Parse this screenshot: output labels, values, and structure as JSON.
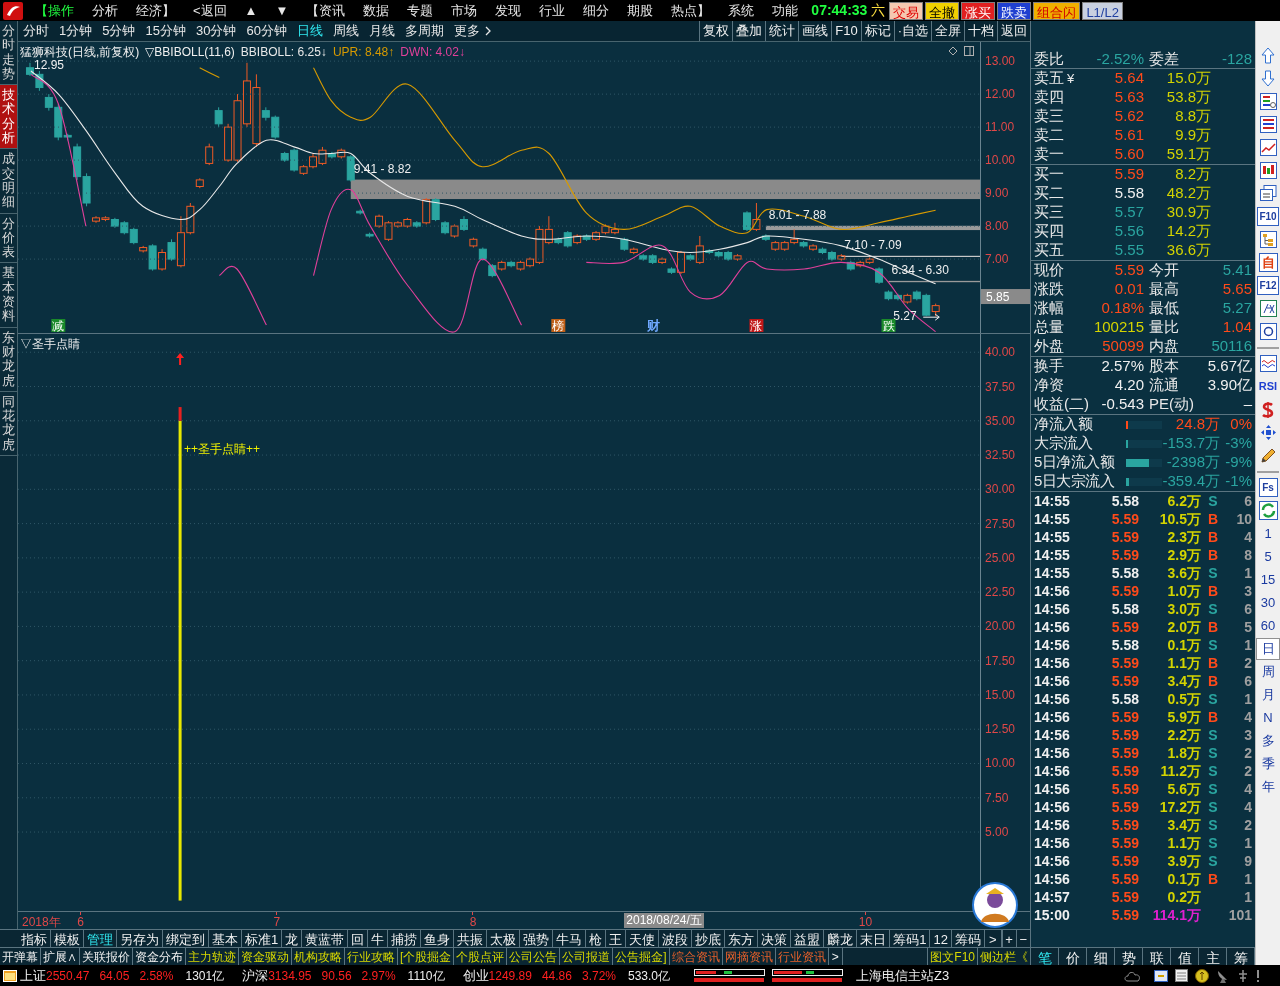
{
  "menu_bar": {
    "items": [
      {
        "label": "【操作",
        "selected": true
      },
      {
        "label": "分析",
        "selected": false
      },
      {
        "label": "经济】",
        "selected": false
      },
      {
        "label": "<返回",
        "selected": false
      },
      {
        "label": "▲",
        "selected": false
      },
      {
        "label": "▼",
        "selected": false
      },
      {
        "label": "【资讯",
        "selected": false
      },
      {
        "label": "数据",
        "selected": false
      },
      {
        "label": "专题",
        "selected": false
      },
      {
        "label": "市场",
        "selected": false
      },
      {
        "label": "发现",
        "selected": false
      },
      {
        "label": "行业",
        "selected": false
      },
      {
        "label": "细分",
        "selected": false
      },
      {
        "label": "期股",
        "selected": false
      },
      {
        "label": "热点】",
        "selected": false
      },
      {
        "label": "系统",
        "selected": false
      },
      {
        "label": "功能",
        "selected": false
      }
    ],
    "clock": "07:44:33",
    "weekday": "六",
    "buttons": [
      {
        "label": "交易",
        "kind": "trade"
      },
      {
        "label": "全撤",
        "kind": "cancel"
      },
      {
        "label": "涨买",
        "kind": "buy"
      },
      {
        "label": "跌卖",
        "kind": "sell"
      },
      {
        "label": "组合闪",
        "kind": "combo"
      },
      {
        "label": "L1/L2",
        "kind": "level"
      }
    ]
  },
  "side_tabs": [
    {
      "label": "分时走势",
      "selected": false
    },
    {
      "label": "技术分析",
      "selected": true
    },
    {
      "label": "成交明细",
      "selected": false
    },
    {
      "label": "分价表",
      "selected": false
    },
    {
      "label": "基本资料",
      "selected": false
    },
    {
      "label": "东财龙虎",
      "selected": false
    },
    {
      "label": "同花龙虎",
      "selected": false
    }
  ],
  "period_tabs": {
    "items": [
      {
        "label": "分时",
        "selected": false
      },
      {
        "label": "1分钟",
        "selected": false
      },
      {
        "label": "5分钟",
        "selected": false
      },
      {
        "label": "15分钟",
        "selected": false
      },
      {
        "label": "30分钟",
        "selected": false
      },
      {
        "label": "60分钟",
        "selected": false
      },
      {
        "label": "日线",
        "selected": true
      },
      {
        "label": "周线",
        "selected": false
      },
      {
        "label": "月线",
        "selected": false
      },
      {
        "label": "多周期",
        "selected": false
      },
      {
        "label": "更多",
        "selected": false
      }
    ],
    "tools": [
      "复权",
      "叠加",
      "统计",
      "画线",
      "F10",
      "标记",
      "·自选",
      "全屏",
      "十档",
      "返回"
    ]
  },
  "price_chart": {
    "title": "猛狮科技(日线,前复权)",
    "indicator": "▽BBIBOLL(11,6)",
    "legend": [
      "BBIBOLL: 6.25↓",
      "UPR: 8.48↑",
      "DWN: 4.02↓"
    ],
    "axis_tag": "5.85",
    "markers": [
      {
        "text": "减",
        "kind": "badge",
        "color": "#1a8a2a"
      },
      {
        "text": "榜",
        "kind": "badge",
        "color": "#c06018"
      },
      {
        "text": "财",
        "kind": "text",
        "color": "#6fa8ff"
      },
      {
        "text": "涨",
        "kind": "badge",
        "color": "#c01818"
      },
      {
        "text": "跌",
        "kind": "badge",
        "color": "#1a8a2a"
      }
    ],
    "chart_data": {
      "type": "line",
      "grid": true,
      "xlim": [
        5.684,
        10.841
      ],
      "ylim": [
        4.76,
        13.58
      ],
      "x": [
        5.75,
        5.89,
        6.03,
        6.18,
        6.32,
        6.51,
        6.61,
        6.71,
        6.8,
        6.95,
        7.09,
        7.19,
        7.28,
        7.38,
        7.48,
        7.67,
        7.91,
        8.05,
        8.25,
        8.39,
        8.58,
        8.77,
        8.97,
        9.11,
        9.26,
        9.4,
        9.5,
        9.69,
        9.88,
        10.07,
        10.22,
        10.36
      ],
      "series": [
        {
          "color": "#e8e8e8",
          "values": [
            12.7,
            12.0,
            10.9,
            9.6,
            8.6,
            8.2,
            8.5,
            9.2,
            9.9,
            10.6,
            10.4,
            10.2,
            10.2,
            10.2,
            9.6,
            8.9,
            8.6,
            8.2,
            7.7,
            7.6,
            7.7,
            7.6,
            7.3,
            7.2,
            7.3,
            7.5,
            7.7,
            7.6,
            7.4,
            7.0,
            6.6,
            6.25
          ]
        },
        {
          "color": "#d79a00",
          "values": [
            null,
            null,
            null,
            null,
            null,
            null,
            12.8,
            12.5,
            null,
            null,
            null,
            12.8,
            11.8,
            11.3,
            11.3,
            12.3,
            10.6,
            9.8,
            10.3,
            10.2,
            8.4,
            7.9,
            8.3,
            8.6,
            8.0,
            7.8,
            8.5,
            8.3,
            7.9,
            8.1,
            8.3,
            8.48
          ]
        },
        {
          "color": "#e0409a",
          "values": [
            12.6,
            11.7,
            8.0,
            null,
            null,
            null,
            null,
            6.5,
            6.7,
            5.0,
            null,
            6.5,
            8.5,
            9.1,
            8.0,
            6.2,
            4.8,
            7.0,
            5.0,
            null,
            6.9,
            6.9,
            7.4,
            6.0,
            5.9,
            6.9,
            6.7,
            6.7,
            6.9,
            6.6,
            5.5,
            4.8
          ]
        }
      ],
      "yticks": [
        {
          "value": 13,
          "label": "13.00"
        },
        {
          "value": 12,
          "label": "12.00"
        },
        {
          "value": 11,
          "label": "11.00"
        },
        {
          "value": 10,
          "label": "10.00"
        },
        {
          "value": 9,
          "label": "9.00"
        },
        {
          "value": 8,
          "label": "8.00"
        },
        {
          "value": 7,
          "label": "7.00"
        }
      ],
      "annotations": [
        "9.41 - 8.82",
        "8.01 - 7.88",
        "7.10 - 7.09",
        "6.34 - 6.30",
        "12.95",
        "5.27"
      ]
    }
  },
  "signal_chart": {
    "title": "▽圣手点睛",
    "chart_data": {
      "type": "bar",
      "stacked": true,
      "grid": true,
      "xlim": [
        5.684,
        10.841
      ],
      "ylim": [
        -0.76,
        41.33
      ],
      "x": [
        6.51
      ],
      "series": [
        {
          "color": "#e8e800",
          "values": [
            35
          ]
        },
        {
          "color": "#e82020",
          "values": [
            1
          ]
        }
      ],
      "xticks": [
        {
          "value": 6,
          "label": "6"
        },
        {
          "value": 7,
          "label": "7"
        },
        {
          "value": 8,
          "label": "8"
        },
        {
          "value": 10,
          "label": "10"
        }
      ],
      "yticks": [
        {
          "value": 40,
          "label": "40.00"
        },
        {
          "value": 37.5,
          "label": "37.50"
        },
        {
          "value": 35,
          "label": "35.00"
        },
        {
          "value": 32.5,
          "label": "32.50"
        },
        {
          "value": 30,
          "label": "30.00"
        },
        {
          "value": 27.5,
          "label": "27.50"
        },
        {
          "value": 25,
          "label": "25.00"
        },
        {
          "value": 22.5,
          "label": "22.50"
        },
        {
          "value": 20,
          "label": "20.00"
        },
        {
          "value": 17.5,
          "label": "17.50"
        },
        {
          "value": 15,
          "label": "15.00"
        },
        {
          "value": 12.5,
          "label": "12.50"
        },
        {
          "value": 10,
          "label": "10.00"
        },
        {
          "value": 7.5,
          "label": "7.50"
        },
        {
          "value": 5,
          "label": "5.00"
        }
      ],
      "annotations": [
        "++圣手点睛++"
      ]
    }
  },
  "date_axis": {
    "year": "2018年",
    "cursor": "2018/08/24/五"
  },
  "indicator_tabs": {
    "items": [
      {
        "label": "指标",
        "selected": false
      },
      {
        "label": "模板",
        "selected": false
      },
      {
        "label": "管理",
        "selected": true
      },
      {
        "label": "另存为",
        "selected": false
      },
      {
        "label": "绑定到",
        "selected": false
      },
      {
        "label": "基本",
        "selected": false
      },
      {
        "label": "标准1",
        "selected": false
      },
      {
        "label": "龙",
        "selected": false
      },
      {
        "label": "黄蓝带",
        "selected": false
      },
      {
        "label": "回",
        "selected": false
      },
      {
        "label": "牛",
        "selected": false
      },
      {
        "label": "捕捞",
        "selected": false
      },
      {
        "label": "鱼身",
        "selected": false
      },
      {
        "label": "共振",
        "selected": false
      },
      {
        "label": "太极",
        "selected": false
      },
      {
        "label": "强势",
        "selected": false
      },
      {
        "label": "牛马",
        "selected": false
      },
      {
        "label": "枪",
        "selected": false
      },
      {
        "label": "王",
        "selected": false
      },
      {
        "label": "天使",
        "selected": false
      },
      {
        "label": "波段",
        "selected": false
      },
      {
        "label": "抄底",
        "selected": false
      },
      {
        "label": "东方",
        "selected": false
      },
      {
        "label": "决策",
        "selected": false
      },
      {
        "label": "益盟",
        "selected": false
      },
      {
        "label": "麟龙",
        "selected": false
      },
      {
        "label": "末日",
        "selected": false
      },
      {
        "label": "筹码1",
        "selected": false
      },
      {
        "label": "12",
        "selected": false
      },
      {
        "label": "筹码",
        "selected": false
      }
    ],
    "more": ">",
    "zoom_buttons": [
      "+",
      "−"
    ]
  },
  "function_tabs": {
    "items": [
      {
        "label": "开弹幕",
        "kind": "tool"
      },
      {
        "label": "扩展∧",
        "kind": "tool"
      },
      {
        "label": "关联报价",
        "kind": "tool"
      },
      {
        "label": "资金分布",
        "kind": "tool"
      },
      {
        "label": "主力轨迹",
        "kind": "feature"
      },
      {
        "label": "资金驱动",
        "kind": "feature"
      },
      {
        "label": "机构攻略",
        "kind": "feature"
      },
      {
        "label": "行业攻略",
        "kind": "feature"
      },
      {
        "label": "[个股掘金",
        "kind": "feature"
      },
      {
        "label": "个股点评",
        "kind": "feature"
      },
      {
        "label": "公司公告",
        "kind": "feature"
      },
      {
        "label": "公司报道",
        "kind": "feature"
      },
      {
        "label": "公告掘金]",
        "kind": "feature"
      },
      {
        "label": "综合资讯",
        "kind": "news"
      },
      {
        "label": "网摘资讯",
        "kind": "news"
      },
      {
        "label": "行业资讯",
        "kind": "news"
      }
    ],
    "more": ">",
    "extras": [
      "图文F10",
      "侧边栏《"
    ]
  },
  "quote_panel": {
    "ratio": {
      "label": "委比",
      "value": "-2.52%",
      "label2": "委差",
      "value2": "-128",
      "color": "#2aa5a0"
    },
    "ask_symbol": "¥",
    "asks": [
      {
        "label": "卖五",
        "price": "5.64",
        "volume": "15.0万",
        "color": "#ff4a1a"
      },
      {
        "label": "卖四",
        "price": "5.63",
        "volume": "53.8万",
        "color": "#ff4a1a"
      },
      {
        "label": "卖三",
        "price": "5.62",
        "volume": "8.8万",
        "color": "#ff4a1a"
      },
      {
        "label": "卖二",
        "price": "5.61",
        "volume": "9.9万",
        "color": "#ff4a1a"
      },
      {
        "label": "卖一",
        "price": "5.60",
        "volume": "59.1万",
        "color": "#ff4a1a"
      }
    ],
    "bids": [
      {
        "label": "买一",
        "price": "5.59",
        "volume": "8.2万",
        "color": "#ff4a1a"
      },
      {
        "label": "买二",
        "price": "5.58",
        "volume": "48.2万",
        "color": "#f0f0f0"
      },
      {
        "label": "买三",
        "price": "5.57",
        "volume": "30.9万",
        "color": "#2aa5a0"
      },
      {
        "label": "买四",
        "price": "5.56",
        "volume": "14.2万",
        "color": "#2aa5a0"
      },
      {
        "label": "买五",
        "price": "5.55",
        "volume": "36.6万",
        "color": "#2aa5a0"
      }
    ],
    "stats": [
      {
        "cells": [
          {
            "label": "现价",
            "value": "5.59",
            "color": "#ff4a1a"
          },
          {
            "label": "今开",
            "value": "5.41",
            "color": "#2aa5a0"
          }
        ]
      },
      {
        "cells": [
          {
            "label": "涨跌",
            "value": "0.01",
            "color": "#ff4a1a"
          },
          {
            "label": "最高",
            "value": "5.65",
            "color": "#ff4a1a"
          }
        ]
      },
      {
        "cells": [
          {
            "label": "涨幅",
            "value": "0.18%",
            "color": "#ff4a1a"
          },
          {
            "label": "最低",
            "value": "5.27",
            "color": "#2aa5a0"
          }
        ]
      },
      {
        "cells": [
          {
            "label": "总量",
            "value": "100215",
            "color": "#d4d400"
          },
          {
            "label": "量比",
            "value": "1.04",
            "color": "#ff4a1a"
          }
        ]
      },
      {
        "cells": [
          {
            "label": "外盘",
            "value": "50099",
            "color": "#ff4a1a"
          },
          {
            "label": "内盘",
            "value": "50116",
            "color": "#2aa5a0"
          }
        ]
      }
    ],
    "fundamentals": [
      {
        "label": "换手",
        "value": "2.57%",
        "label2": "股本",
        "value2": "5.67亿"
      },
      {
        "label": "净资",
        "value": "4.20",
        "label2": "流通",
        "value2": "3.90亿"
      },
      {
        "label": "收益(二)",
        "value": "-0.543",
        "label2": "PE(动)",
        "value2": "–"
      }
    ],
    "flows": [
      {
        "label": "净流入额",
        "level": 0.06,
        "amount": "24.8万",
        "pct": "0%",
        "color": "#ff4a1a"
      },
      {
        "label": "大宗流入",
        "level": 0.06,
        "amount": "-153.7万",
        "pct": "-3%",
        "color": "#2aa5a0"
      },
      {
        "label": "5日净流入额",
        "level": 0.64,
        "amount": "-2398万",
        "pct": "-9%",
        "color": "#2aa5a0"
      },
      {
        "label": "5日大宗流入",
        "level": 0.08,
        "amount": "-359.4万",
        "pct": "-1%",
        "color": "#2aa5a0"
      }
    ],
    "ticks": [
      {
        "time": "14:55",
        "price": "5.58",
        "color": "#f0f0f0",
        "volume": "6.2万",
        "side": "S",
        "kind": "sell",
        "count": "6",
        "big": false
      },
      {
        "time": "14:55",
        "price": "5.59",
        "color": "#ff4a1a",
        "volume": "10.5万",
        "side": "B",
        "kind": "buy",
        "count": "10",
        "big": false
      },
      {
        "time": "14:55",
        "price": "5.59",
        "color": "#ff4a1a",
        "volume": "2.3万",
        "side": "B",
        "kind": "buy",
        "count": "4",
        "big": false
      },
      {
        "time": "14:55",
        "price": "5.59",
        "color": "#ff4a1a",
        "volume": "2.9万",
        "side": "B",
        "kind": "buy",
        "count": "8",
        "big": false
      },
      {
        "time": "14:55",
        "price": "5.58",
        "color": "#f0f0f0",
        "volume": "3.6万",
        "side": "S",
        "kind": "sell",
        "count": "1",
        "big": false
      },
      {
        "time": "14:56",
        "price": "5.59",
        "color": "#ff4a1a",
        "volume": "1.0万",
        "side": "B",
        "kind": "buy",
        "count": "3",
        "big": false
      },
      {
        "time": "14:56",
        "price": "5.58",
        "color": "#f0f0f0",
        "volume": "3.0万",
        "side": "S",
        "kind": "sell",
        "count": "6",
        "big": false
      },
      {
        "time": "14:56",
        "price": "5.59",
        "color": "#ff4a1a",
        "volume": "2.0万",
        "side": "B",
        "kind": "buy",
        "count": "5",
        "big": false
      },
      {
        "time": "14:56",
        "price": "5.58",
        "color": "#f0f0f0",
        "volume": "0.1万",
        "side": "S",
        "kind": "sell",
        "count": "1",
        "big": false
      },
      {
        "time": "14:56",
        "price": "5.59",
        "color": "#ff4a1a",
        "volume": "1.1万",
        "side": "B",
        "kind": "buy",
        "count": "2",
        "big": false
      },
      {
        "time": "14:56",
        "price": "5.59",
        "color": "#ff4a1a",
        "volume": "3.4万",
        "side": "B",
        "kind": "buy",
        "count": "6",
        "big": false
      },
      {
        "time": "14:56",
        "price": "5.58",
        "color": "#f0f0f0",
        "volume": "0.5万",
        "side": "S",
        "kind": "sell",
        "count": "1",
        "big": false
      },
      {
        "time": "14:56",
        "price": "5.59",
        "color": "#ff4a1a",
        "volume": "5.9万",
        "side": "B",
        "kind": "buy",
        "count": "4",
        "big": false
      },
      {
        "time": "14:56",
        "price": "5.59",
        "color": "#ff4a1a",
        "volume": "2.2万",
        "side": "S",
        "kind": "sell",
        "count": "3",
        "big": false
      },
      {
        "time": "14:56",
        "price": "5.59",
        "color": "#ff4a1a",
        "volume": "1.8万",
        "side": "S",
        "kind": "sell",
        "count": "2",
        "big": false
      },
      {
        "time": "14:56",
        "price": "5.59",
        "color": "#ff4a1a",
        "volume": "11.2万",
        "side": "S",
        "kind": "sell",
        "count": "2",
        "big": false
      },
      {
        "time": "14:56",
        "price": "5.59",
        "color": "#ff4a1a",
        "volume": "5.6万",
        "side": "S",
        "kind": "sell",
        "count": "4",
        "big": false
      },
      {
        "time": "14:56",
        "price": "5.59",
        "color": "#ff4a1a",
        "volume": "17.2万",
        "side": "S",
        "kind": "sell",
        "count": "4",
        "big": false
      },
      {
        "time": "14:56",
        "price": "5.59",
        "color": "#ff4a1a",
        "volume": "3.4万",
        "side": "S",
        "kind": "sell",
        "count": "2",
        "big": false
      },
      {
        "time": "14:56",
        "price": "5.59",
        "color": "#ff4a1a",
        "volume": "1.1万",
        "side": "S",
        "kind": "sell",
        "count": "1",
        "big": false
      },
      {
        "time": "14:56",
        "price": "5.59",
        "color": "#ff4a1a",
        "volume": "3.9万",
        "side": "S",
        "kind": "sell",
        "count": "9",
        "big": false
      },
      {
        "time": "14:56",
        "price": "5.59",
        "color": "#ff4a1a",
        "volume": "0.1万",
        "side": "B",
        "kind": "buy",
        "count": "1",
        "big": false
      },
      {
        "time": "14:57",
        "price": "5.59",
        "color": "#ff4a1a",
        "volume": "0.2万",
        "count": "1",
        "big": false
      },
      {
        "time": "15:00",
        "price": "5.59",
        "color": "#ff4a1a",
        "volume": "114.1万",
        "count": "101",
        "big": true
      }
    ]
  },
  "panel_tabs": [
    {
      "label": "笔",
      "selected": true
    },
    {
      "label": "价",
      "selected": false
    },
    {
      "label": "细",
      "selected": false
    },
    {
      "label": "势",
      "selected": false
    },
    {
      "label": "联",
      "selected": false
    },
    {
      "label": "值",
      "selected": false
    },
    {
      "label": "主",
      "selected": false
    },
    {
      "label": "筹",
      "selected": false
    }
  ],
  "side_toolbar": {
    "labels": [
      "F10",
      "自",
      "F12",
      "RSI",
      "Fs"
    ],
    "periods": [
      {
        "label": "1",
        "selected": false
      },
      {
        "label": "5",
        "selected": false
      },
      {
        "label": "15",
        "selected": false
      },
      {
        "label": "30",
        "selected": false
      },
      {
        "label": "60",
        "selected": false
      },
      {
        "label": "日",
        "selected": true
      },
      {
        "label": "周",
        "selected": false
      },
      {
        "label": "月",
        "selected": false
      },
      {
        "label": "N",
        "selected": false
      },
      {
        "label": "多",
        "selected": false
      },
      {
        "label": "季",
        "selected": false
      },
      {
        "label": "年",
        "selected": false
      }
    ]
  },
  "status_bar": {
    "indices": [
      {
        "label": "上证",
        "value": "2550.47",
        "change": "64.05",
        "pct": "2.58%",
        "amount": "1301亿",
        "up": true
      },
      {
        "label": "沪深",
        "value": "3134.95",
        "change": "90.56",
        "pct": "2.97%",
        "amount": "1110亿",
        "up": true
      },
      {
        "label": "创业",
        "value": "1249.89",
        "change": "44.86",
        "pct": "3.72%",
        "amount": "533.0亿",
        "up": true
      }
    ],
    "server": "上海电信主站Z3"
  }
}
